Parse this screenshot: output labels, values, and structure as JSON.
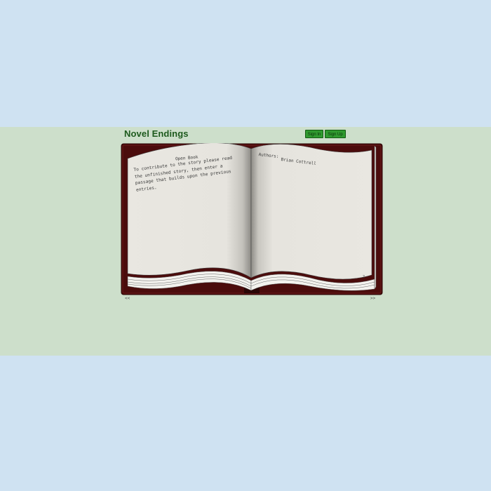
{
  "site": {
    "title": "Novel Endings"
  },
  "auth": {
    "sign_in": "Sign In",
    "sign_up": "Sign Up"
  },
  "book": {
    "left_page": {
      "heading": "Open Book",
      "body": "To contribute to the story please read\nthe unfinished story, then enter a\npassage that builds upon the previous\nentries."
    },
    "right_page": {
      "heading": "Authors:",
      "author": "Brian Cottrell",
      "page_number": "2"
    }
  },
  "nav": {
    "prev": "<<",
    "next": ">>"
  },
  "colors": {
    "page_background": "#cfe2f2",
    "content_band": "#cddfcb",
    "title_green": "#1d5a1d",
    "button_green": "#2f9a2f",
    "book_cover": "#4a0c0c",
    "paper": "#e8e6e0"
  }
}
